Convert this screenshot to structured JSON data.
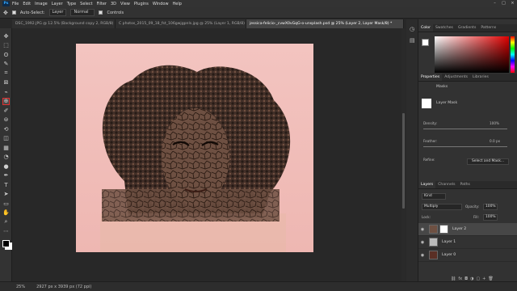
{
  "menu": [
    "File",
    "Edit",
    "Image",
    "Layer",
    "Type",
    "Select",
    "Filter",
    "3D",
    "View",
    "Plugins",
    "Window",
    "Help"
  ],
  "app_logo": "Ps",
  "window_controls": [
    "–",
    "□",
    "×"
  ],
  "options": {
    "auto_select_label": "Auto-Select:",
    "auto_select_value": "Layer",
    "mode": "Normal",
    "controls_label": "Controls"
  },
  "doc_tabs": [
    {
      "label": "DSC_1992.JPG @ 12.5% (Background copy 2, RGB/8) *",
      "active": false
    },
    {
      "label": "C photos_2015_09_18_fst_106gwjgpnls.jpg @ 25% (Layer 1, RGB/8) *",
      "active": false
    },
    {
      "label": "jessica-felicio-_cvwX0vGqG-o-unsplash.psd @ 25% (Layer 2, Layer Mask/8) *",
      "active": true
    }
  ],
  "tool_icons": [
    "move-icon",
    "marquee-icon",
    "lasso-icon",
    "quick-select-icon",
    "crop-icon",
    "frame-icon",
    "eyedropper-icon",
    "healing-icon",
    "brush-icon",
    "clone-stamp-icon",
    "history-brush-icon",
    "eraser-icon",
    "gradient-icon",
    "blur-icon",
    "dodge-icon",
    "pen-icon",
    "type-icon",
    "path-select-icon",
    "shape-icon",
    "hand-icon",
    "zoom-icon",
    "more-tools-icon"
  ],
  "tool_glyphs": [
    "✥",
    "⬚",
    "ʘ",
    "✎",
    "⌗",
    "⊠",
    "⌁",
    "⊕",
    "✐",
    "⊜",
    "⟲",
    "◫",
    "▦",
    "◔",
    "●",
    "✒",
    "T",
    "➤",
    "▭",
    "✋",
    "⌕",
    "⋯"
  ],
  "status": {
    "zoom": "25%",
    "doc_info": "2927 px x 3939 px (72 ppi)"
  },
  "color_panel": {
    "tabs": [
      "Color",
      "Swatches",
      "Gradients",
      "Patterns"
    ]
  },
  "properties_panel": {
    "tabs": [
      "Properties",
      "Adjustments",
      "Libraries"
    ],
    "masks_label": "Masks",
    "layer_mask_label": "Layer Mask",
    "density_label": "Density:",
    "density_value": "100%",
    "feather_label": "Feather:",
    "feather_value": "0.0 px",
    "refine_label": "Refine:",
    "select_mask_button": "Select and Mask..."
  },
  "layers_panel": {
    "tabs": [
      "Layers",
      "Channels",
      "Paths"
    ],
    "kind": "Kind",
    "blend_mode": "Multiply",
    "opacity_label": "Opacity:",
    "opacity_value": "100%",
    "lock_label": "Lock:",
    "fill_label": "Fill:",
    "fill_value": "100%",
    "layers": [
      {
        "name": "Layer 2",
        "active": true
      },
      {
        "name": "Layer 1",
        "active": false
      },
      {
        "name": "Layer 0",
        "active": false
      }
    ],
    "footer_icons": [
      "link-icon",
      "fx-icon",
      "mask-icon",
      "adjustment-icon",
      "group-icon",
      "new-layer-icon",
      "trash-icon"
    ],
    "footer_glyphs": [
      "⛓",
      "fx",
      "◘",
      "◑",
      "▢",
      "+",
      "🗑"
    ]
  },
  "colors": {
    "accent": "#31a8ff",
    "selected_tool_border": "#e03030",
    "canvas_bg": "#f0bdb8"
  }
}
